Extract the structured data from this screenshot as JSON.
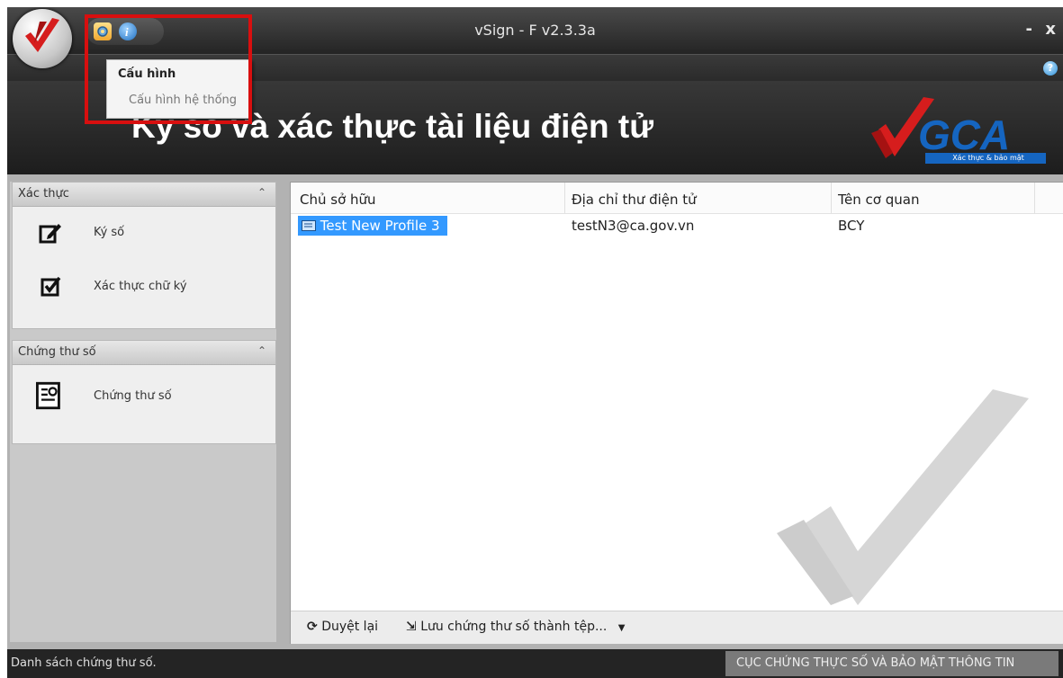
{
  "window": {
    "title": "vSign - F v2.3.3a",
    "minimize": "-",
    "close": "x"
  },
  "help_button": "?",
  "quick_access": {
    "config_icon": "gear-icon",
    "info_icon": "info-icon"
  },
  "menu": {
    "header": "Cấu hình",
    "item": "Cấu hình hệ thống"
  },
  "banner": {
    "title": "Ký số và xác thực tài liệu điện tử",
    "logo_text": "Xác thực & bảo mật"
  },
  "sidebar": {
    "groups": [
      {
        "title": "Xác thực",
        "items": [
          {
            "label": "Ký số",
            "icon": "sign-icon"
          },
          {
            "label": "Xác thực chữ ký",
            "icon": "verify-icon"
          }
        ]
      },
      {
        "title": "Chứng thư số",
        "items": [
          {
            "label": "Chứng thư số",
            "icon": "certificate-icon"
          }
        ]
      }
    ]
  },
  "table": {
    "columns": [
      "Chủ sở hữu",
      "Địa chỉ thư điện tử",
      "Tên cơ quan"
    ],
    "rows": [
      {
        "owner": "Test New Profile 3",
        "email": "testN3@ca.gov.vn",
        "org": "BCY"
      }
    ]
  },
  "toolbar": {
    "refresh": "Duyệt lại",
    "save": "Lưu chứng thư số thành tệp..."
  },
  "status": {
    "left": "Danh sách chứng thư số.",
    "right": "CỤC CHỨNG THỰC SỐ VÀ BẢO MẬT THÔNG TIN"
  },
  "colors": {
    "accent": "#d80f0f",
    "selection": "#3399ff",
    "logo_blue": "#1565c0"
  }
}
